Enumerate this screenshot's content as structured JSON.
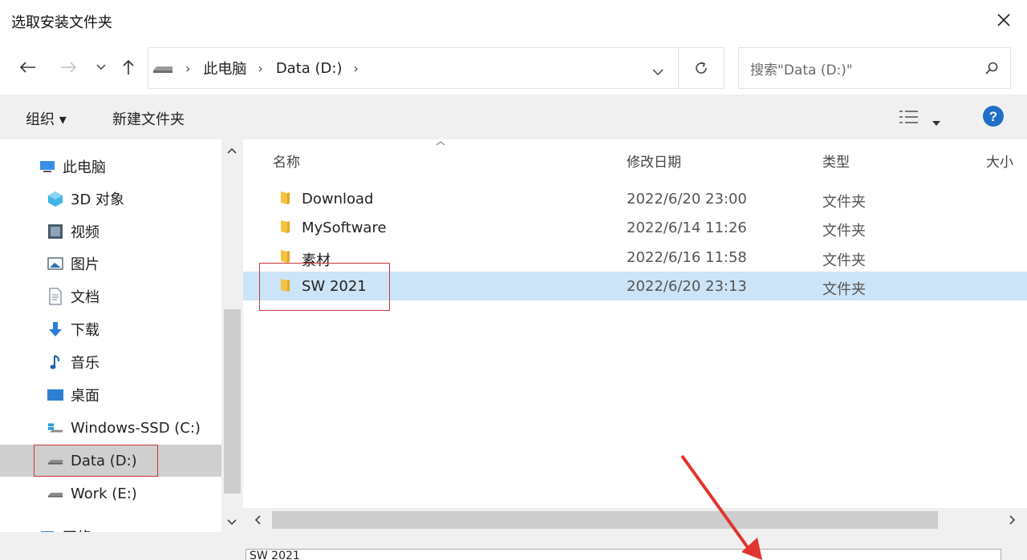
{
  "window": {
    "title": "选取安装文件夹"
  },
  "addressbar": {
    "crumbs": [
      "此电脑",
      "Data (D:)"
    ],
    "search_placeholder": "搜索\"Data (D:)\""
  },
  "toolbar": {
    "organize": "组织 ▾",
    "new_folder": "新建文件夹"
  },
  "sidebar": {
    "items": [
      {
        "label": "此电脑",
        "icon": "computer-icon"
      },
      {
        "label": "3D 对象",
        "icon": "cube-icon"
      },
      {
        "label": "视频",
        "icon": "video-icon"
      },
      {
        "label": "图片",
        "icon": "picture-icon"
      },
      {
        "label": "文档",
        "icon": "document-icon"
      },
      {
        "label": "下载",
        "icon": "download-icon"
      },
      {
        "label": "音乐",
        "icon": "music-icon"
      },
      {
        "label": "桌面",
        "icon": "desktop-icon"
      },
      {
        "label": "Windows-SSD (C:)",
        "icon": "drive-icon"
      },
      {
        "label": "Data (D:)",
        "icon": "drive-icon"
      },
      {
        "label": "Work (E:)",
        "icon": "drive-icon"
      },
      {
        "label": "网络",
        "icon": "network-icon"
      }
    ]
  },
  "columns": {
    "name": "名称",
    "modified": "修改日期",
    "type": "类型",
    "size": "大小"
  },
  "files": [
    {
      "name": "Download",
      "modified": "2022/6/20 23:00",
      "type": "文件夹"
    },
    {
      "name": "MySoftware",
      "modified": "2022/6/14 11:26",
      "type": "文件夹"
    },
    {
      "name": "素材",
      "modified": "2022/6/16 11:58",
      "type": "文件夹"
    },
    {
      "name": "SW 2021",
      "modified": "2022/6/20 23:13",
      "type": "文件夹"
    }
  ],
  "filename_field": {
    "value": "SW 2021"
  },
  "colors": {
    "selection": "#cce4f7",
    "highlight_box": "#c9373a",
    "help_blue": "#1f6fc6",
    "folder": "#f5c242"
  }
}
